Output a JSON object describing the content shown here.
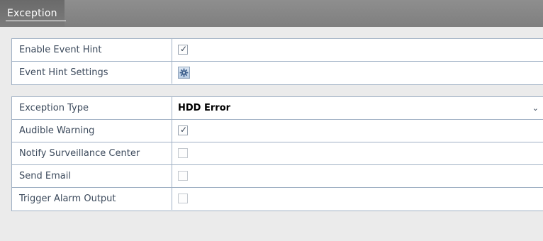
{
  "tab": {
    "label": "Exception"
  },
  "hint_group": {
    "enable_event_hint": {
      "label": "Enable Event Hint",
      "checked": true
    },
    "event_hint_settings": {
      "label": "Event Hint Settings",
      "icon": "gear-icon"
    }
  },
  "exception_group": {
    "exception_type": {
      "label": "Exception Type",
      "value": "HDD Error"
    },
    "audible_warning": {
      "label": "Audible Warning",
      "checked": true
    },
    "notify_surveillance_center": {
      "label": "Notify Surveillance Center",
      "checked": false
    },
    "send_email": {
      "label": "Send Email",
      "checked": false
    },
    "trigger_alarm_output": {
      "label": "Trigger Alarm Output",
      "checked": false
    }
  },
  "icons": {
    "check": "✓",
    "chevron": "⌄"
  },
  "colors": {
    "border": "#9fb0c4",
    "label_text": "#3c4a5c",
    "titlebar": "#7f7f7f"
  }
}
